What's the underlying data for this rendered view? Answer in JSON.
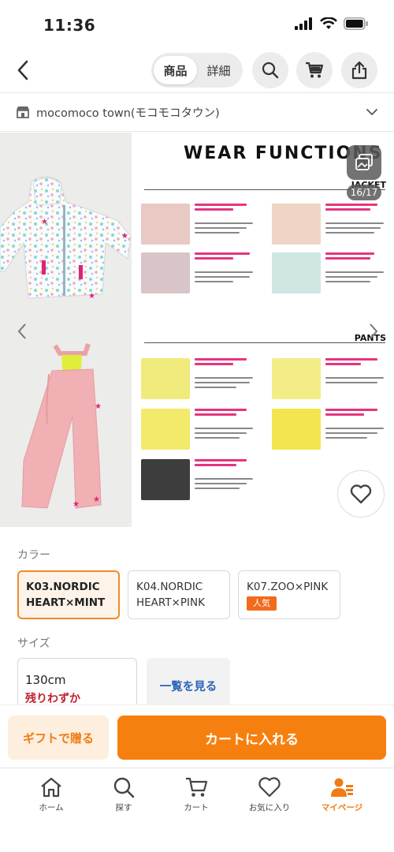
{
  "status": {
    "time": "11:36"
  },
  "nav": {
    "segments": [
      "商品",
      "詳細"
    ],
    "active_segment": 0
  },
  "shop": {
    "name": "mocomoco town(モコモコタウン)"
  },
  "gallery": {
    "title": "WEAR FUNCTIONS",
    "section_jacket": "JACKET",
    "section_pants": "PANTS",
    "counter": "16/17"
  },
  "color": {
    "label": "カラー",
    "options": [
      {
        "line1": "K03.NORDIC",
        "line2": "HEART×MINT",
        "selected": true
      },
      {
        "line1": "K04.NORDIC",
        "line2": "HEART×PINK",
        "selected": false
      },
      {
        "line1": "K07.ZOO×PINK",
        "badge": "人気",
        "selected": false
      }
    ]
  },
  "size": {
    "label": "サイズ",
    "value": "130cm",
    "stock": "残りわずか",
    "list_button": "一覧を見る"
  },
  "actions": {
    "gift": "ギフトで贈る",
    "cart": "カートに入れる"
  },
  "tabs": [
    {
      "label": "ホーム",
      "icon": "home-icon"
    },
    {
      "label": "探す",
      "icon": "search-icon"
    },
    {
      "label": "カート",
      "icon": "cart-icon"
    },
    {
      "label": "お気に入り",
      "icon": "heart-icon"
    },
    {
      "label": "マイページ",
      "icon": "mypage-icon",
      "active": true
    }
  ],
  "colors": {
    "accent": "#f6800f",
    "stock_red": "#c3202c",
    "link_blue": "#2a62b8"
  }
}
